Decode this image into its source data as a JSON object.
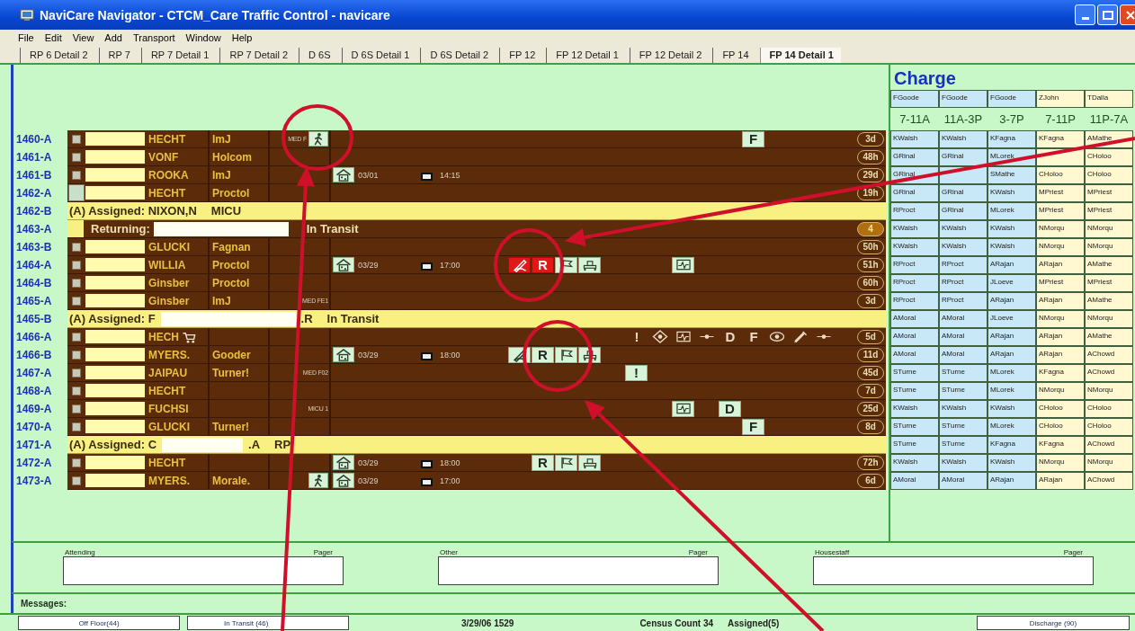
{
  "window": {
    "title": "NaviCare Navigator - CTCM_Care Traffic Control - navicare"
  },
  "menu": [
    "File",
    "Edit",
    "View",
    "Add",
    "Transport",
    "Window",
    "Help"
  ],
  "tabs": [
    {
      "label": "RP 6 Detail 2",
      "selected": false
    },
    {
      "label": "RP 7",
      "selected": false
    },
    {
      "label": "RP 7 Detail 1",
      "selected": false
    },
    {
      "label": "RP 7 Detail 2",
      "selected": false
    },
    {
      "label": "D 6S",
      "selected": false
    },
    {
      "label": "D 6S Detail 1",
      "selected": false
    },
    {
      "label": "D 6S Detail 2",
      "selected": false
    },
    {
      "label": "FP 12",
      "selected": false
    },
    {
      "label": "FP 12 Detail 1",
      "selected": false
    },
    {
      "label": "FP 12 Detail 2",
      "selected": false
    },
    {
      "label": "FP 14",
      "selected": false
    },
    {
      "label": "FP 14 Detail 1",
      "selected": true
    }
  ],
  "patients": [
    {
      "bed": "1460-A",
      "kind": "patient",
      "marker_large": false,
      "doctor": "HECHT",
      "service": "ImJ",
      "location": "MED F",
      "walk": true,
      "icons": [
        {
          "kind": "f_tag",
          "label": "F",
          "boxed": true,
          "alert": false
        }
      ],
      "badge": "3d",
      "badge_alert": false
    },
    {
      "bed": "1461-A",
      "kind": "patient",
      "marker_large": false,
      "doctor": "VONF",
      "service": "Holcom",
      "badge": "48h",
      "badge_alert": false
    },
    {
      "bed": "1461-B",
      "kind": "patient",
      "marker_large": false,
      "doctor": "ROOKA",
      "service": "ImJ",
      "transport": {
        "date": "03/01",
        "time": "14:15"
      },
      "badge": "29d",
      "badge_alert": false
    },
    {
      "bed": "1462-A",
      "kind": "patient",
      "marker_large": true,
      "doctor": "HECHT",
      "service": "Proctol",
      "badge": "19h",
      "badge_alert": false
    },
    {
      "bed": "1462-B",
      "kind": "banner",
      "segments": [
        {
          "text": "(A) Assigned: NIXON,N"
        },
        {
          "text": "MICU"
        }
      ]
    },
    {
      "bed": "1463-A",
      "kind": "returning",
      "segments": [
        {
          "text": "Returning:"
        },
        {
          "kind": "blank_wide"
        },
        {
          "text": "In Transit"
        }
      ],
      "badge": "4",
      "badge_alert": true
    },
    {
      "bed": "1463-B",
      "kind": "patient",
      "marker_large": false,
      "doctor": "GLUCKI",
      "service": "Fagnan",
      "badge": "50h",
      "badge_alert": false
    },
    {
      "bed": "1464-A",
      "kind": "patient",
      "marker_large": false,
      "doctor": "WILLIA",
      "service": "Proctol",
      "transport": {
        "date": "03/29",
        "time": "17:00"
      },
      "icons": [
        {
          "kind": "pen",
          "boxed": true,
          "alert": true
        },
        {
          "kind": "r_tag",
          "label": "R",
          "boxed": true,
          "alert": true
        },
        {
          "kind": "flag",
          "boxed": true,
          "alert": false
        },
        {
          "kind": "bed",
          "boxed": true,
          "alert": false
        },
        {
          "kind": "monitor",
          "boxed": true,
          "alert": false
        }
      ],
      "badge": "51h",
      "badge_alert": false
    },
    {
      "bed": "1464-B",
      "kind": "patient",
      "marker_large": false,
      "doctor": "Ginsber",
      "service": "Proctol",
      "badge": "60h",
      "badge_alert": false
    },
    {
      "bed": "1465-A",
      "kind": "patient",
      "marker_large": false,
      "doctor": "Ginsber",
      "service": "ImJ",
      "location": "MED FE1",
      "badge": "3d",
      "badge_alert": false
    },
    {
      "bed": "1465-B",
      "kind": "banner",
      "segments": [
        {
          "text": "(A) Assigned: F"
        },
        {
          "kind": "blank_wide"
        },
        {
          "text": ".R"
        },
        {
          "text": "In Transit"
        }
      ]
    },
    {
      "bed": "1466-A",
      "kind": "patient",
      "marker_large": false,
      "doctor": "HECH",
      "cart": true,
      "icons": [
        {
          "kind": "alert_tag",
          "label": "!",
          "boxed": false,
          "alert": false
        },
        {
          "kind": "diamond",
          "boxed": false,
          "alert": false
        },
        {
          "kind": "monitor",
          "boxed": false,
          "alert": false
        },
        {
          "kind": "dot",
          "boxed": false,
          "alert": false
        },
        {
          "kind": "d_tag",
          "label": "D",
          "boxed": false,
          "alert": false
        },
        {
          "kind": "f_tag",
          "label": "F",
          "boxed": false,
          "alert": false
        },
        {
          "kind": "eye",
          "boxed": false,
          "alert": false
        },
        {
          "kind": "syringe",
          "boxed": false,
          "alert": false
        },
        {
          "kind": "end_dot",
          "boxed": false,
          "alert": false
        }
      ],
      "badge": "5d",
      "badge_alert": false
    },
    {
      "bed": "1466-B",
      "kind": "patient",
      "marker_large": false,
      "doctor": "MYERS.",
      "service": "Gooder",
      "transport": {
        "date": "03/29",
        "time": "18:00"
      },
      "icons": [
        {
          "kind": "pen",
          "boxed": true,
          "alert": false
        },
        {
          "kind": "r_tag",
          "label": "R",
          "boxed": true,
          "alert": false
        },
        {
          "kind": "flag",
          "boxed": true,
          "alert": false
        },
        {
          "kind": "bed",
          "boxed": true,
          "alert": false
        }
      ],
      "badge": "11d",
      "badge_alert": false
    },
    {
      "bed": "1467-A",
      "kind": "patient",
      "marker_large": false,
      "doctor": "JAIPAU",
      "service": "Turner!",
      "location": "MED F02",
      "icons": [
        {
          "kind": "alert_tag",
          "label": "!",
          "boxed": true,
          "alert": false
        }
      ],
      "badge": "45d",
      "badge_alert": false
    },
    {
      "bed": "1468-A",
      "kind": "patient",
      "marker_large": false,
      "doctor": "HECHT",
      "badge": "7d",
      "badge_alert": false
    },
    {
      "bed": "1469-A",
      "kind": "patient",
      "marker_large": false,
      "doctor": "FUCHSI",
      "location": "MICU 1",
      "icons": [
        {
          "kind": "monitor",
          "boxed": true,
          "alert": false
        },
        {
          "kind": "d_tag",
          "label": "D",
          "boxed": true,
          "alert": false
        }
      ],
      "badge": "25d",
      "badge_alert": false
    },
    {
      "bed": "1470-A",
      "kind": "patient",
      "marker_large": false,
      "doctor": "GLUCKI",
      "service": "Turner!",
      "icons": [
        {
          "kind": "f_tag",
          "label": "F",
          "boxed": true,
          "alert": false
        }
      ],
      "badge": "8d",
      "badge_alert": false
    },
    {
      "bed": "1471-A",
      "kind": "banner",
      "segments": [
        {
          "text": "(A) Assigned: C"
        },
        {
          "kind": "blank"
        },
        {
          "text": ".A"
        },
        {
          "text": "RP"
        }
      ]
    },
    {
      "bed": "1472-A",
      "kind": "patient",
      "marker_large": false,
      "doctor": "HECHT",
      "transport": {
        "date": "03/29",
        "time": "18:00"
      },
      "icons": [
        {
          "kind": "r_tag",
          "label": "R",
          "boxed": true,
          "alert": false
        },
        {
          "kind": "flag",
          "boxed": true,
          "alert": false
        },
        {
          "kind": "bed",
          "boxed": true,
          "alert": false
        }
      ],
      "badge": "72h",
      "badge_alert": false
    },
    {
      "bed": "1473-A",
      "kind": "patient",
      "marker_large": false,
      "doctor": "MYERS.",
      "service": "Morale.",
      "walk": true,
      "transport": {
        "date": "03/29",
        "time": "17:00"
      },
      "badge": "6d",
      "badge_alert": false
    }
  ],
  "charge": {
    "title": "Charge",
    "columns": [
      {
        "lead": "FGoode",
        "shift": "7-11A",
        "kind": "day"
      },
      {
        "lead": "FGoode",
        "shift": "11A-3P",
        "kind": "day"
      },
      {
        "lead": "FGoode",
        "shift": "3-7P",
        "kind": "day"
      },
      {
        "lead": "ZJohn",
        "shift": "7-11P",
        "kind": "night"
      },
      {
        "lead": "TDalla",
        "shift": "11P-7A",
        "kind": "night"
      }
    ],
    "rows": [
      [
        "KWalsh",
        "KWalsh",
        "KFagna",
        "KFagna",
        "AMathe"
      ],
      {
        "shift_1": "GRinal",
        "shift_2": "GRinal",
        "shift_3": "MLorek",
        "shift_5": "CHoloo"
      },
      {
        "shift_1": "GRinal",
        "shift_3": "SMathe",
        "shift_4": "CHoloo",
        "shift_5": "CHoloo"
      },
      [
        "GRinal",
        "GRinal",
        "KWalsh",
        "MPriest",
        "MPriest"
      ],
      [
        "RProct",
        "GRinal",
        "MLorek",
        "MPriest",
        "MPriest"
      ],
      [
        "KWalsh",
        "KWalsh",
        "KWalsh",
        "NMorqu",
        "NMorqu"
      ],
      [
        "KWalsh",
        "KWalsh",
        "KWalsh",
        "NMorqu",
        "NMorqu"
      ],
      [
        "RProct",
        "RProct",
        "ARajan",
        "ARajan",
        "AMathe"
      ],
      [
        "RProct",
        "RProct",
        "JLoeve",
        "MPriest",
        "MPriest"
      ],
      [
        "RProct",
        "RProct",
        "ARajan",
        "ARajan",
        "AMathe"
      ],
      [
        "AMoral",
        "AMoral",
        "JLoeve",
        "NMorqu",
        "NMorqu"
      ],
      [
        "AMoral",
        "AMoral",
        "ARajan",
        "ARajan",
        "AMathe"
      ],
      [
        "AMoral",
        "AMoral",
        "ARajan",
        "ARajan",
        "AChowd"
      ],
      [
        "STurne",
        "STurne",
        "MLorek",
        "KFagna",
        "AChowd"
      ],
      [
        "STurne",
        "STurne",
        "MLorek",
        "NMorqu",
        "NMorqu"
      ],
      [
        "KWalsh",
        "KWalsh",
        "KWalsh",
        "CHoloo",
        "CHoloo"
      ],
      [
        "STurne",
        "STurne",
        "MLorek",
        "CHoloo",
        "CHoloo"
      ],
      [
        "STurne",
        "STurne",
        "KFagna",
        "KFagna",
        "AChowd"
      ],
      [
        "KWalsh",
        "KWalsh",
        "KWalsh",
        "NMorqu",
        "NMorqu"
      ],
      [
        "AMoral",
        "AMoral",
        "ARajan",
        "ARajan",
        "AChowd"
      ]
    ]
  },
  "contacts": [
    {
      "label": "Attending",
      "pager_label": "Pager"
    },
    {
      "label": "Other",
      "pager_label": "Pager"
    },
    {
      "label": "Housestaff",
      "pager_label": "Pager"
    }
  ],
  "messages_label": "Messages:",
  "status_bar": [
    {
      "kind": "button",
      "text": "Off Floor(44)"
    },
    {
      "kind": "button",
      "text": "In Transit (46)"
    },
    {
      "kind": "text",
      "text": "3/29/06  1529"
    },
    {
      "kind": "text",
      "text": "Census Count  34"
    },
    {
      "kind": "text",
      "text": "Assigned(5)"
    },
    {
      "kind": "button",
      "text": "Discharge (90)"
    }
  ]
}
